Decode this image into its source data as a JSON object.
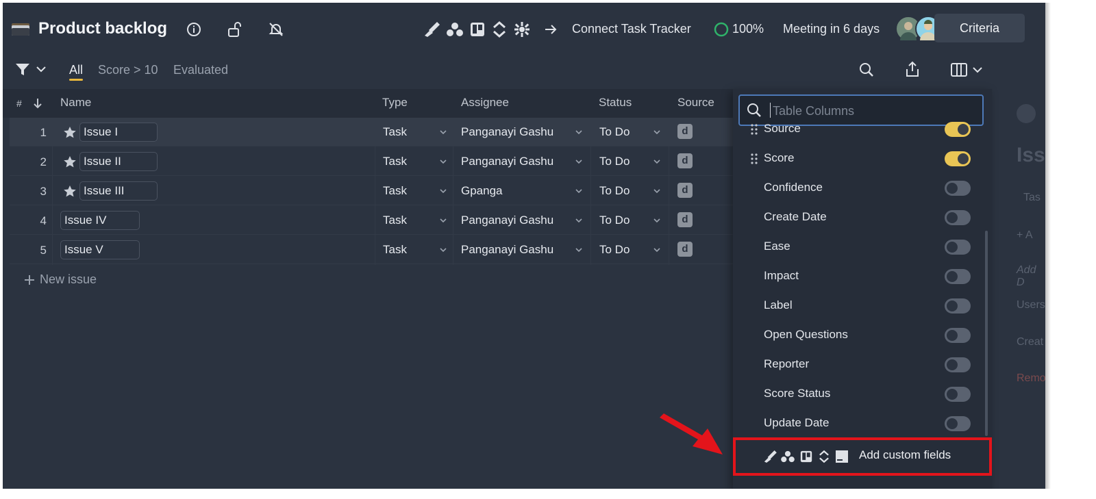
{
  "header": {
    "title": "Product backlog",
    "connect_label": "Connect Task Tracker",
    "progress_label": "100%",
    "progress_value": 1.0,
    "meeting_label": "Meeting in 6 days",
    "criteria_label": "Criteria",
    "integration_icons": [
      "jira-icon",
      "asana-icon",
      "trello-icon",
      "sync-icon",
      "clickup-icon"
    ]
  },
  "filters": {
    "tabs": [
      {
        "label": "All",
        "active": true
      },
      {
        "label": "Score > 10",
        "active": false
      },
      {
        "label": "Evaluated",
        "active": false
      }
    ]
  },
  "table": {
    "columns": {
      "num": "#",
      "name": "Name",
      "type": "Type",
      "assignee": "Assignee",
      "status": "Status",
      "source": "Source"
    },
    "rows": [
      {
        "num": "1",
        "name": "Issue I",
        "starred": true,
        "type": "Task",
        "assignee": "Panganayi Gashu",
        "status": "To Do",
        "source": "d"
      },
      {
        "num": "2",
        "name": "Issue II",
        "starred": true,
        "type": "Task",
        "assignee": "Panganayi Gashu",
        "status": "To Do",
        "source": "d"
      },
      {
        "num": "3",
        "name": "Issue III",
        "starred": true,
        "type": "Task",
        "assignee": "Gpanga",
        "status": "To Do",
        "source": "d"
      },
      {
        "num": "4",
        "name": "Issue IV",
        "starred": false,
        "type": "Task",
        "assignee": "Panganayi Gashu",
        "status": "To Do",
        "source": "d"
      },
      {
        "num": "5",
        "name": "Issue V",
        "starred": false,
        "type": "Task",
        "assignee": "Panganayi Gashu",
        "status": "To Do",
        "source": "d"
      }
    ],
    "new_issue_label": "New issue"
  },
  "side_panel": {
    "title_fragment": "Iss",
    "type_fragment": "Tas",
    "add_fragment": "A",
    "add_desc_fragment": "Add D",
    "users_fragment": "Users",
    "created_fragment": "Creat",
    "remove_fragment": "Remo"
  },
  "columns_menu": {
    "search_placeholder": "Table Columns",
    "options": [
      {
        "label": "Source",
        "enabled": true,
        "draggable": true
      },
      {
        "label": "Score",
        "enabled": true,
        "draggable": true
      },
      {
        "label": "Confidence",
        "enabled": false,
        "draggable": false
      },
      {
        "label": "Create Date",
        "enabled": false,
        "draggable": false
      },
      {
        "label": "Ease",
        "enabled": false,
        "draggable": false
      },
      {
        "label": "Impact",
        "enabled": false,
        "draggable": false
      },
      {
        "label": "Label",
        "enabled": false,
        "draggable": false
      },
      {
        "label": "Open Questions",
        "enabled": false,
        "draggable": false
      },
      {
        "label": "Reporter",
        "enabled": false,
        "draggable": false
      },
      {
        "label": "Score Status",
        "enabled": false,
        "draggable": false
      },
      {
        "label": "Update Date",
        "enabled": false,
        "draggable": false
      }
    ],
    "add_custom_fields_label": "Add custom fields"
  },
  "colors": {
    "background": "#2b3340",
    "accent_yellow": "#e9c555",
    "progress_green": "#2fb36a",
    "highlight_red": "#e3141b",
    "search_border": "#4d79b8"
  }
}
